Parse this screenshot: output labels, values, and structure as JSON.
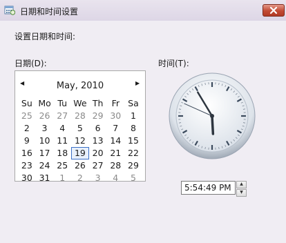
{
  "window": {
    "title": "日期和时间设置"
  },
  "heading": "设置日期和时间:",
  "date_label": "日期(D):",
  "time_label": "时间(T):",
  "calendar": {
    "month_label": "May, 2010",
    "weekdays": [
      "Su",
      "Mo",
      "Tu",
      "We",
      "Th",
      "Fr",
      "Sa"
    ],
    "weeks": [
      [
        "25",
        "26",
        "27",
        "28",
        "29",
        "30",
        "1"
      ],
      [
        "2",
        "3",
        "4",
        "5",
        "6",
        "7",
        "8"
      ],
      [
        "9",
        "10",
        "11",
        "12",
        "13",
        "14",
        "15"
      ],
      [
        "16",
        "17",
        "18",
        "19",
        "20",
        "21",
        "22"
      ],
      [
        "23",
        "24",
        "25",
        "26",
        "27",
        "28",
        "29"
      ],
      [
        "30",
        "31",
        "1",
        "2",
        "3",
        "4",
        "5"
      ]
    ],
    "selected_day": "19"
  },
  "clock": {
    "hours": 5,
    "minutes": 54,
    "seconds": 49
  },
  "time_value": "5:54:49 PM",
  "icons": {
    "app": "calendar-clock-icon",
    "close": "close-icon",
    "prev": "prev-month-icon",
    "next": "next-month-icon"
  },
  "colors": {
    "close_button": "#c24a33",
    "selection_border": "#3a6fc7"
  }
}
